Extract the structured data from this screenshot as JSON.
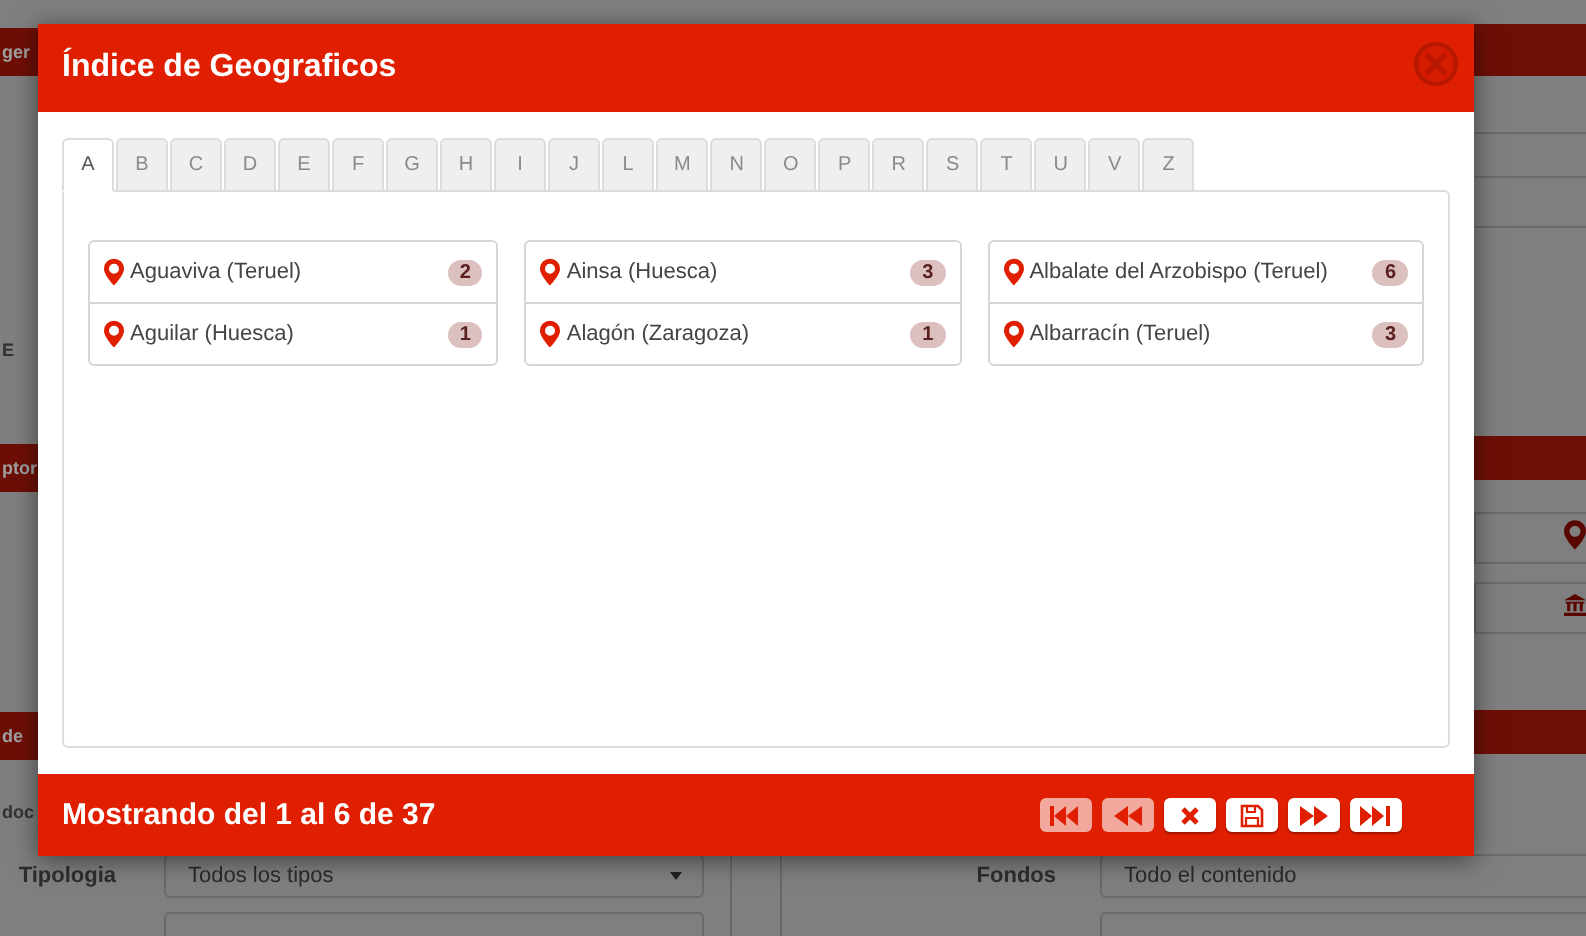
{
  "background_page": {
    "left_fragments": [
      "ger",
      "E",
      "ptor",
      "de",
      "doc"
    ],
    "filters": [
      {
        "label": "Tipologia",
        "value": "Todos los tipos",
        "kind": "select"
      },
      {
        "label": "Fondos",
        "value": "Todo el contenido",
        "kind": "text"
      }
    ]
  },
  "dialog": {
    "title": "Índice de Geograficos",
    "tabs": [
      {
        "label": "A",
        "selected": true
      },
      {
        "label": "B",
        "selected": false
      },
      {
        "label": "C",
        "selected": false
      },
      {
        "label": "D",
        "selected": false
      },
      {
        "label": "E",
        "selected": false
      },
      {
        "label": "F",
        "selected": false
      },
      {
        "label": "G",
        "selected": false
      },
      {
        "label": "H",
        "selected": false
      },
      {
        "label": "I",
        "selected": false
      },
      {
        "label": "J",
        "selected": false
      },
      {
        "label": "L",
        "selected": false
      },
      {
        "label": "M",
        "selected": false
      },
      {
        "label": "N",
        "selected": false
      },
      {
        "label": "O",
        "selected": false
      },
      {
        "label": "P",
        "selected": false
      },
      {
        "label": "R",
        "selected": false
      },
      {
        "label": "S",
        "selected": false
      },
      {
        "label": "T",
        "selected": false
      },
      {
        "label": "U",
        "selected": false
      },
      {
        "label": "V",
        "selected": false
      },
      {
        "label": "Z",
        "selected": false
      }
    ],
    "columns": [
      [
        {
          "name": "Aguaviva (Teruel)",
          "count": "2"
        },
        {
          "name": "Aguilar (Huesca)",
          "count": "1"
        }
      ],
      [
        {
          "name": "Ainsa (Huesca)",
          "count": "3"
        },
        {
          "name": "Alagón (Zaragoza)",
          "count": "1"
        }
      ],
      [
        {
          "name": "Albalate del Arzobispo (Teruel)",
          "count": "6"
        },
        {
          "name": "Albarracín (Teruel)",
          "count": "3"
        }
      ]
    ],
    "footer": {
      "summary": "Mostrando del 1 al 6 de 37",
      "buttons": [
        {
          "kind": "first",
          "disabled": true
        },
        {
          "kind": "prev",
          "disabled": true
        },
        {
          "kind": "cancel",
          "disabled": false
        },
        {
          "kind": "save",
          "disabled": false
        },
        {
          "kind": "next",
          "disabled": false
        },
        {
          "kind": "last",
          "disabled": false
        }
      ]
    }
  }
}
